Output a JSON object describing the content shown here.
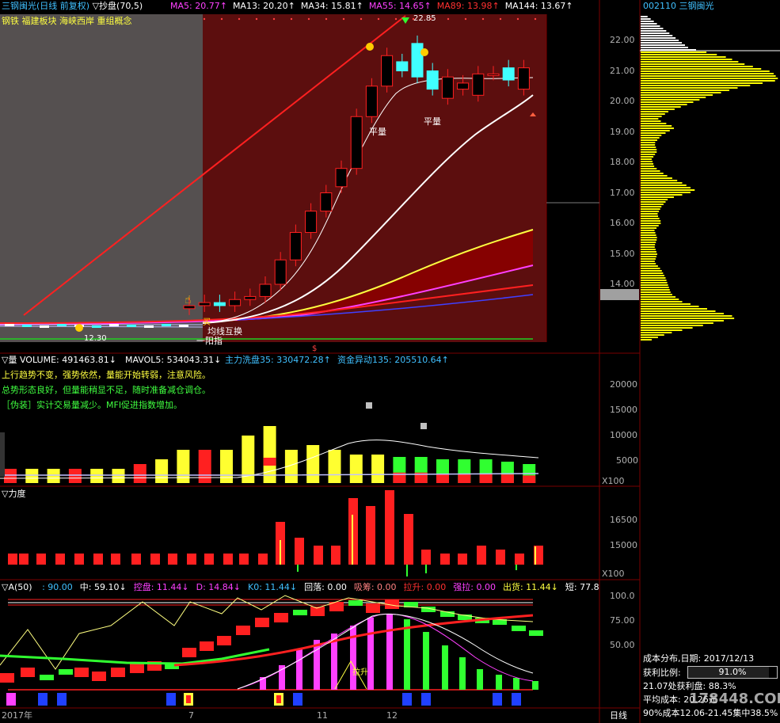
{
  "header": {
    "stock_name": "三钢闽光",
    "period": "(日线 前复权)",
    "indicator": "▽抄盘(70,5)",
    "ma": [
      {
        "label": "MA5: 20.77↑",
        "color": "#ff40ff"
      },
      {
        "label": "MA13: 20.20↑",
        "color": "#ffffff"
      },
      {
        "label": "MA34: 15.81↑",
        "color": "#ffffff"
      },
      {
        "label": "MA55: 14.65↑",
        "color": "#ff40ff"
      },
      {
        "label": "MA89: 13.98↑",
        "color": "#ff3030"
      },
      {
        "label": "MA144: 13.67↑",
        "color": "#ffffff"
      }
    ],
    "concepts": "钢铁 福建板块 海峡西岸 重组概念"
  },
  "main_chart": {
    "price_axis": [
      "22.00",
      "21.00",
      "20.00",
      "19.00",
      "18.00",
      "17.00",
      "16.00",
      "15.00",
      "14.00"
    ],
    "high_label": "22.85",
    "low_label": "12.30",
    "annotations": [
      "平量",
      "平量",
      "均线互换",
      "一阳指",
      "买"
    ],
    "price_data": {
      "dates_shown": [
        "2017年",
        "7",
        "11",
        "12"
      ],
      "candles": [
        {
          "o": 13.2,
          "c": 13.3
        },
        {
          "o": 13.3,
          "c": 13.4
        },
        {
          "o": 13.4,
          "c": 13.3
        },
        {
          "o": 13.3,
          "c": 13.5
        },
        {
          "o": 13.5,
          "c": 13.6
        },
        {
          "o": 13.6,
          "c": 14.0
        },
        {
          "o": 14.0,
          "c": 14.8
        },
        {
          "o": 14.8,
          "c": 15.7
        },
        {
          "o": 15.7,
          "c": 16.4
        },
        {
          "o": 16.4,
          "c": 17.0
        },
        {
          "o": 17.2,
          "c": 17.8
        },
        {
          "o": 17.8,
          "c": 19.5
        },
        {
          "o": 19.5,
          "c": 20.5
        },
        {
          "o": 20.5,
          "c": 21.5
        },
        {
          "o": 21.3,
          "c": 21.0
        },
        {
          "o": 21.9,
          "c": 20.8
        },
        {
          "o": 21.0,
          "c": 20.4
        },
        {
          "o": 20.1,
          "c": 20.8
        },
        {
          "o": 20.4,
          "c": 20.6
        },
        {
          "o": 20.2,
          "c": 20.9
        },
        {
          "o": 20.9,
          "c": 20.9
        },
        {
          "o": 21.1,
          "c": 20.7
        },
        {
          "o": 20.4,
          "c": 21.1
        }
      ]
    }
  },
  "volume_panel": {
    "title": "▽量 VOLUME: 491463.81↓",
    "mavol": "MAVOL5: 534043.31↓",
    "main_force": "主力洗盘35: 330472.28↑",
    "fund_move": "资金异动135: 205510.64↑",
    "notes": [
      {
        "text": "上行趋势不变，强势依然，量能开始转弱，注意风险。",
        "color": "#ffff40"
      },
      {
        "text": "总势形态良好，但量能稍显不足，随时准备减仓调仓。",
        "color": "#40ff40"
      },
      {
        "text": "［伪装］实计交易量减少。MFI促进指数增加。",
        "color": "#40ff40"
      }
    ],
    "axis": [
      "20000",
      "15000",
      "10000",
      "5000"
    ],
    "unit": "X100",
    "values": [
      3,
      3,
      3,
      3,
      3,
      3,
      4,
      5,
      7,
      7,
      7,
      10,
      12,
      7,
      8,
      7,
      6,
      6,
      5.5,
      5.5,
      5,
      5,
      5,
      4.5,
      4
    ]
  },
  "force_panel": {
    "title": "▽力度",
    "axis": [
      "16500",
      "15000"
    ],
    "unit": "X100"
  },
  "a_panel": {
    "title": "▽A(50)",
    "items": [
      {
        "label": ": 90.00",
        "color": "#40c0ff"
      },
      {
        "label": "中: 59.10↓",
        "color": "#ffffff"
      },
      {
        "label": "控盘: 11.44↓",
        "color": "#ff40ff"
      },
      {
        "label": "D: 14.84↓",
        "color": "#ff40ff"
      },
      {
        "label": "K0: 11.44↓",
        "color": "#40c0ff"
      },
      {
        "label": "回落: 0.00",
        "color": "#ffffff"
      },
      {
        "label": "吸筹: 0.00",
        "color": "#ff8080"
      },
      {
        "label": "拉升: 0.00",
        "color": "#ff3030"
      },
      {
        "label": "强拉: 0.00",
        "color": "#ff40ff"
      },
      {
        "label": "出货: 11.44↓",
        "color": "#ffff40"
      },
      {
        "label": "短: 77.8",
        "color": "#ffffff"
      }
    ],
    "axis": [
      "100.0",
      "75.00",
      "50.00"
    ],
    "label_rise": "拉升"
  },
  "date_axis": {
    "labels": [
      "2017年",
      "7",
      "11",
      "12"
    ],
    "period_label": "日线"
  },
  "right_panel": {
    "title": "002110 三钢闽光",
    "cost_title": "成本分布,日期: 2017/12/13",
    "profit_ratio_label": "获利比例:",
    "profit_ratio_value": "91.0%",
    "profit_ratio_fill": 0.91,
    "line1": "21.07处获利盘: 88.3%",
    "line2": "平均成本: 20.26元",
    "line3": "90%成本12.06-21.45集中38.5%",
    "watermark": "178448.COM"
  },
  "colors": {
    "up": "#ff2020",
    "down": "#40ffff",
    "bg_main": "#5c0e0e",
    "bg_grey": "#555050",
    "axis_line": "#7a0000"
  }
}
